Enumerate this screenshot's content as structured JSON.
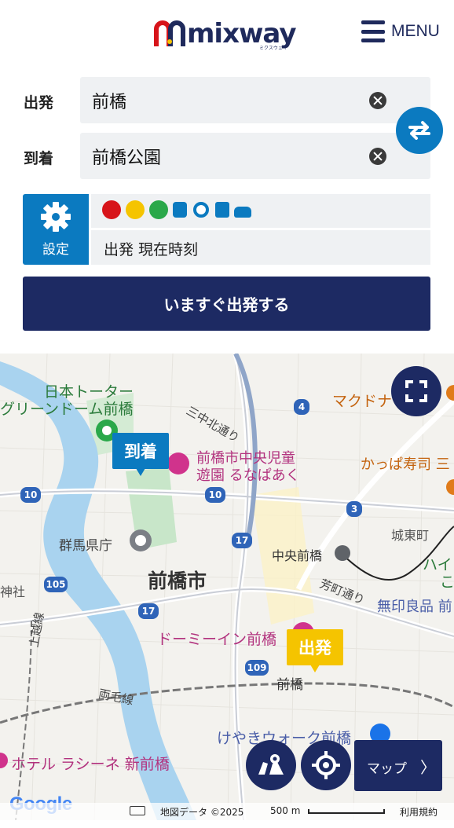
{
  "header": {
    "logo_text": "mixway",
    "logo_sub": "ミクスウェイ",
    "menu_label": "MENU"
  },
  "form": {
    "from_label": "出発",
    "from_value": "前橋",
    "to_label": "到着",
    "to_value": "前橋公園",
    "settings_label": "設定",
    "time_text": "出発 現在時刻",
    "transport_modes": [
      "share-cycle-icon",
      "bicycle-yellow-icon",
      "bicycle-green-icon",
      "train-icon",
      "subway-icon",
      "bus-icon",
      "car-icon"
    ],
    "depart_button": "いますぐ出発する"
  },
  "map": {
    "pin_arrive": "到着",
    "pin_depart": "出発",
    "map_button": "マップ",
    "map_button_chevron": "〉",
    "attribution_data": "地図データ ©2025",
    "scale_label": "500 m",
    "terms_label": "利用規約",
    "google": "Google",
    "labels": {
      "l1": "日本トーター",
      "l2": "グリーンドーム前橋",
      "l3": "三中北通り",
      "l4": "前橋市中央児童",
      "l5": "遊園 るなぱあく",
      "l6": "マクドナ",
      "l7": "かっぱ寿司 三",
      "l8": "群馬県庁",
      "l9": "前橋市",
      "l10": "中央前橋",
      "l11": "城東町",
      "l12": "芳町通り",
      "l13": "無印良品 前",
      "l14": "ドーミーイン前橋",
      "l15": "前橋",
      "l16": "両毛線",
      "l17": "上越線",
      "l18": "けやきウォーク前橋",
      "l19": "ホテル ラシーネ 新前橋",
      "l20": "神社",
      "l21": "ハイ",
      "l22": "こ"
    },
    "route_shields": [
      "4",
      "10",
      "10",
      "3",
      "17",
      "105",
      "17",
      "109"
    ],
    "colors": {
      "river": "#a9d3ef",
      "park": "#c8e6c9",
      "poi_pink": "#d0338c",
      "poi_orange": "#d96a0e"
    }
  },
  "colors": {
    "navy": "#1d2a63",
    "blue": "#0b7ac0",
    "yellow": "#f5c400",
    "input_bg": "#eff1f3"
  }
}
